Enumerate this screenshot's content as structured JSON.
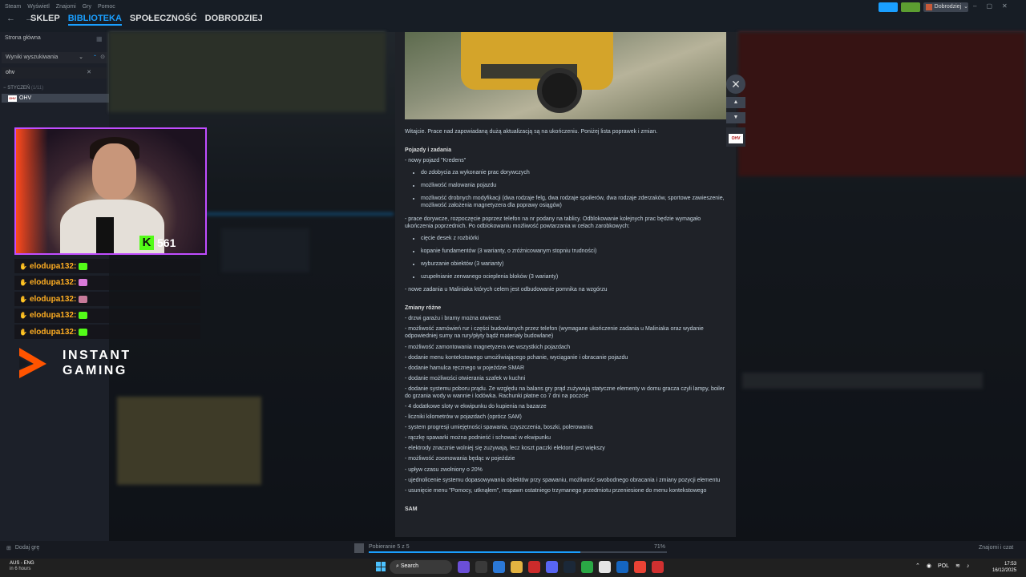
{
  "titlebar": {
    "menu": [
      "Steam",
      "Wyświetl",
      "Znajomi",
      "Gry",
      "Pomoc"
    ],
    "nav": [
      "SKLEP",
      "BIBLIOTEKA",
      "SPOŁECZNOŚĆ",
      "DOBRODZIEJ"
    ],
    "active_nav": "BIBLIOTEKA",
    "user_name": "Dobrodziej",
    "buttons": [
      "broadcast-icon",
      "bell-icon"
    ],
    "window_controls": [
      "minimize-icon",
      "restore-icon",
      "close-icon"
    ]
  },
  "sidebar": {
    "home": "Strona główna",
    "filter": "Wyniki wyszukiwania",
    "search_value": "ohv",
    "section": "STYCZEŃ",
    "section_count": "(1/11)",
    "game_icon_text": "OHV",
    "game": "OHV"
  },
  "overlay": {
    "streamer_badge_count": "561",
    "streamer_badge_letter": "K",
    "chat": [
      {
        "user": "elodupa132:",
        "emote": "green"
      },
      {
        "user": "elodupa132:",
        "emote": "pink"
      },
      {
        "user": "elodupa132:",
        "emote": "pink"
      },
      {
        "user": "elodupa132:",
        "emote": "green"
      },
      {
        "user": "elodupa132:",
        "emote": "green"
      }
    ],
    "sponsor_line1": "INSTANT",
    "sponsor_line2": "GAMING",
    "colors": {
      "accent": "#c04dff",
      "kick_green": "#53fc18",
      "chat_name": "#ffae22",
      "sponsor_orange": "#ff5400"
    }
  },
  "article": {
    "intro": "Witajcie. Prace nad zapowiadaną dużą aktualizacją są na ukończeniu. Poniżej lista poprawek i zmian.",
    "section1_title": "Pojazdy i zadania",
    "line_new_vehicle": "- nowy pojazd \"Kredens\"",
    "vehicle_bullets": [
      "do zdobycia za wykonanie prac dorywczych",
      "możliwość malowania pojazdu",
      "możliwość drobnych modyfikacji (dwa rodzaje felg, dwa rodzaje spoilerów, dwa rodzaje zderzaków, sportowe zawieszenie, możliwość założenia magnetyzera dla poprawy osiągów)"
    ],
    "line_jobs": "- prace dorywcze, rozpoczęcie poprzez telefon na nr podany na tablicy. Odblokowanie kolejnych prac będzie wymagało ukończenia poprzednich. Po odblokowaniu możliwość powtarzania w celach zarobkowych:",
    "job_bullets": [
      "cięcie desek z rozbiórki",
      "kopanie fundamentów (3 warianty, o zróżnicowanym stopniu trudności)",
      "wyburzanie obiektów (3 warianty)",
      "uzupełnianie zerwanego ocieplenia bloków (3 warianty)"
    ],
    "line_maliniak": "- nowe zadania u Maliniaka których celem jest odbudowanie pomnika na wzgórzu",
    "section2_title": "Zmiany różne",
    "changes": [
      "- drzwi garażu i bramy można otwierać",
      "- możliwość zamówień rur i części budowlanych przez telefon (wymagane ukończenie zadania u Maliniaka oraz wydanie odpowiedniej sumy na rury/płyty bądź materiały budowlane)",
      "- możliwość zamontowania magnetyzera we wszystkich pojazdach",
      "- dodanie menu kontekstowego umożliwiającego pchanie, wyciąganie i obracanie pojazdu",
      "- dodanie hamulca ręcznego w pojeździe SMAR",
      "- dodanie możliwości otwierania szafek w kuchni",
      "- dodanie systemu poboru prądu. Ze względu na balans gry prąd zużywają statyczne elementy w domu gracza czyli lampy, boiler do grzania wody w wannie i lodówka. Rachunki płatne co 7 dni na poczcie",
      "- 4 dodatkowe sloty w ekwipunku do kupienia na bazarze",
      "- liczniki kilometrów w pojazdach (oprócz SAM)",
      "- system progresji umiejętności spawania, czyszczenia, boszki, polerowania",
      "- rączkę spawarki można podnieść i schować w ekwipunku",
      "- elektrody znacznie wolniej się zużywają, lecz koszt paczki elektord jest większy",
      "- możliwość zoomowania będąc w pojeździe",
      "- upływ czasu zwolniony o 20%",
      "- ujednolicenie systemu dopasowywania obiektów przy spawaniu, możliwość swobodnego obracania i zmiany pozycji elementu",
      "- usunięcie menu \"Pomocy, utknąłem\", respawn ostatniego trzymanego przedmiotu przeniesione do menu kontekstowego"
    ],
    "section3_title": "SAM",
    "side_badge_text": "OHV"
  },
  "statusbar": {
    "add_game": "Dodaj grę",
    "download": "Pobieranie 5 z 5",
    "progress_percent": 71,
    "progress_label": "71%",
    "friends": "Znajomi i czat"
  },
  "taskbar": {
    "weather_line1": "AUS - ENG",
    "weather_line2": "in 6 hours",
    "search": "Search",
    "language": "POL",
    "time": "17:53",
    "date": "16/12/2025"
  }
}
